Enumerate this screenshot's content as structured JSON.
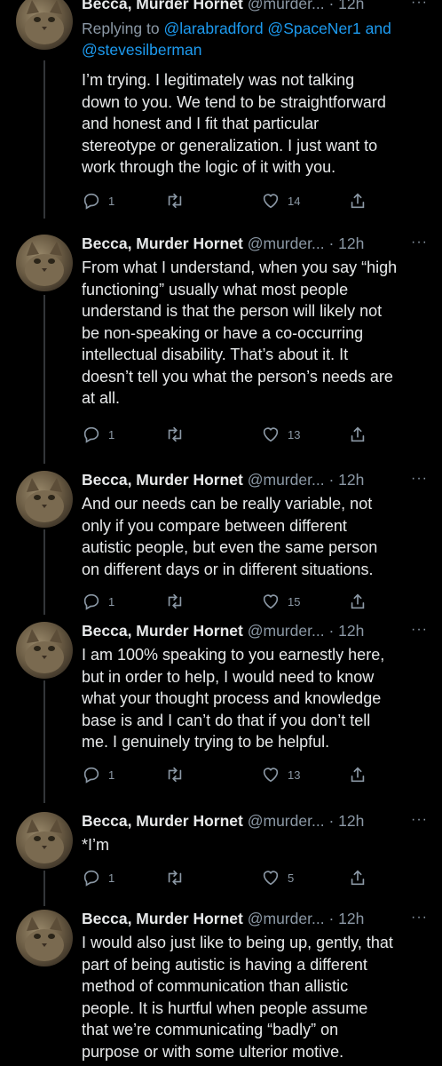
{
  "tweets": [
    {
      "name": "Becca, Murder Hornet",
      "handle": "@murder...",
      "time": "· 12h",
      "more": "···",
      "replying_prefix": "Replying to",
      "replying_to": "@larabradford @SpaceNer1 and",
      "replying_to_2": "@stevesilberman",
      "lines": [
        "I’m trying. I legitimately was not talking",
        "down to you. We tend to be straightforward",
        "and honest and I fit that particular",
        "stereotype or generalization. I just want to",
        "work through the logic of it with you."
      ],
      "replies": "1",
      "likes": "14"
    },
    {
      "name": "Becca, Murder Hornet",
      "handle": "@murder...",
      "time": "· 12h",
      "more": "···",
      "lines": [
        "From what I understand, when you say “high",
        "functioning” usually what most people",
        "understand is that the person will likely not",
        "be non-speaking or have a co-occurring",
        "intellectual disability. That’s about it. It",
        "doesn’t tell you what the person’s needs are",
        "at all."
      ],
      "replies": "1",
      "likes": "13"
    },
    {
      "name": "Becca, Murder Hornet",
      "handle": "@murder...",
      "time": "· 12h",
      "more": "···",
      "lines": [
        "And our needs can be really variable, not",
        "only if you compare between different",
        "autistic people, but even the same person",
        "on different days or in different situations."
      ],
      "replies": "1",
      "likes": "15"
    },
    {
      "name": "Becca, Murder Hornet",
      "handle": "@murder...",
      "time": "· 12h",
      "more": "···",
      "lines": [
        "I am 100% speaking to you earnestly here,",
        "but in order to help, I would need to know",
        "what your thought process and knowledge",
        "base is and I can’t do that if you don’t tell",
        "me. I  genuinely trying to be helpful."
      ],
      "replies": "1",
      "likes": "13"
    },
    {
      "name": "Becca, Murder Hornet",
      "handle": "@murder...",
      "time": "· 12h",
      "more": "···",
      "lines": [
        "*I’m"
      ],
      "replies": "1",
      "likes": "5"
    },
    {
      "name": "Becca, Murder Hornet",
      "handle": "@murder...",
      "time": "· 12h",
      "more": "···",
      "lines": [
        "I would also just like to being up, gently, that",
        "part of being autistic is having a different",
        "method of communication than allistic",
        "people. It is hurtful when people assume",
        "that we’re communicating “badly” on",
        "purpose or with some ulterior motive."
      ]
    }
  ],
  "icons": {
    "reply": "reply-icon",
    "retweet": "retweet-icon",
    "like": "like-icon",
    "share": "share-icon",
    "avatar": "cat-avatar"
  },
  "colors": {
    "background": "#000000",
    "text": "#e7e9ea",
    "secondary": "#8b98a5",
    "link": "#1d9bf0"
  }
}
